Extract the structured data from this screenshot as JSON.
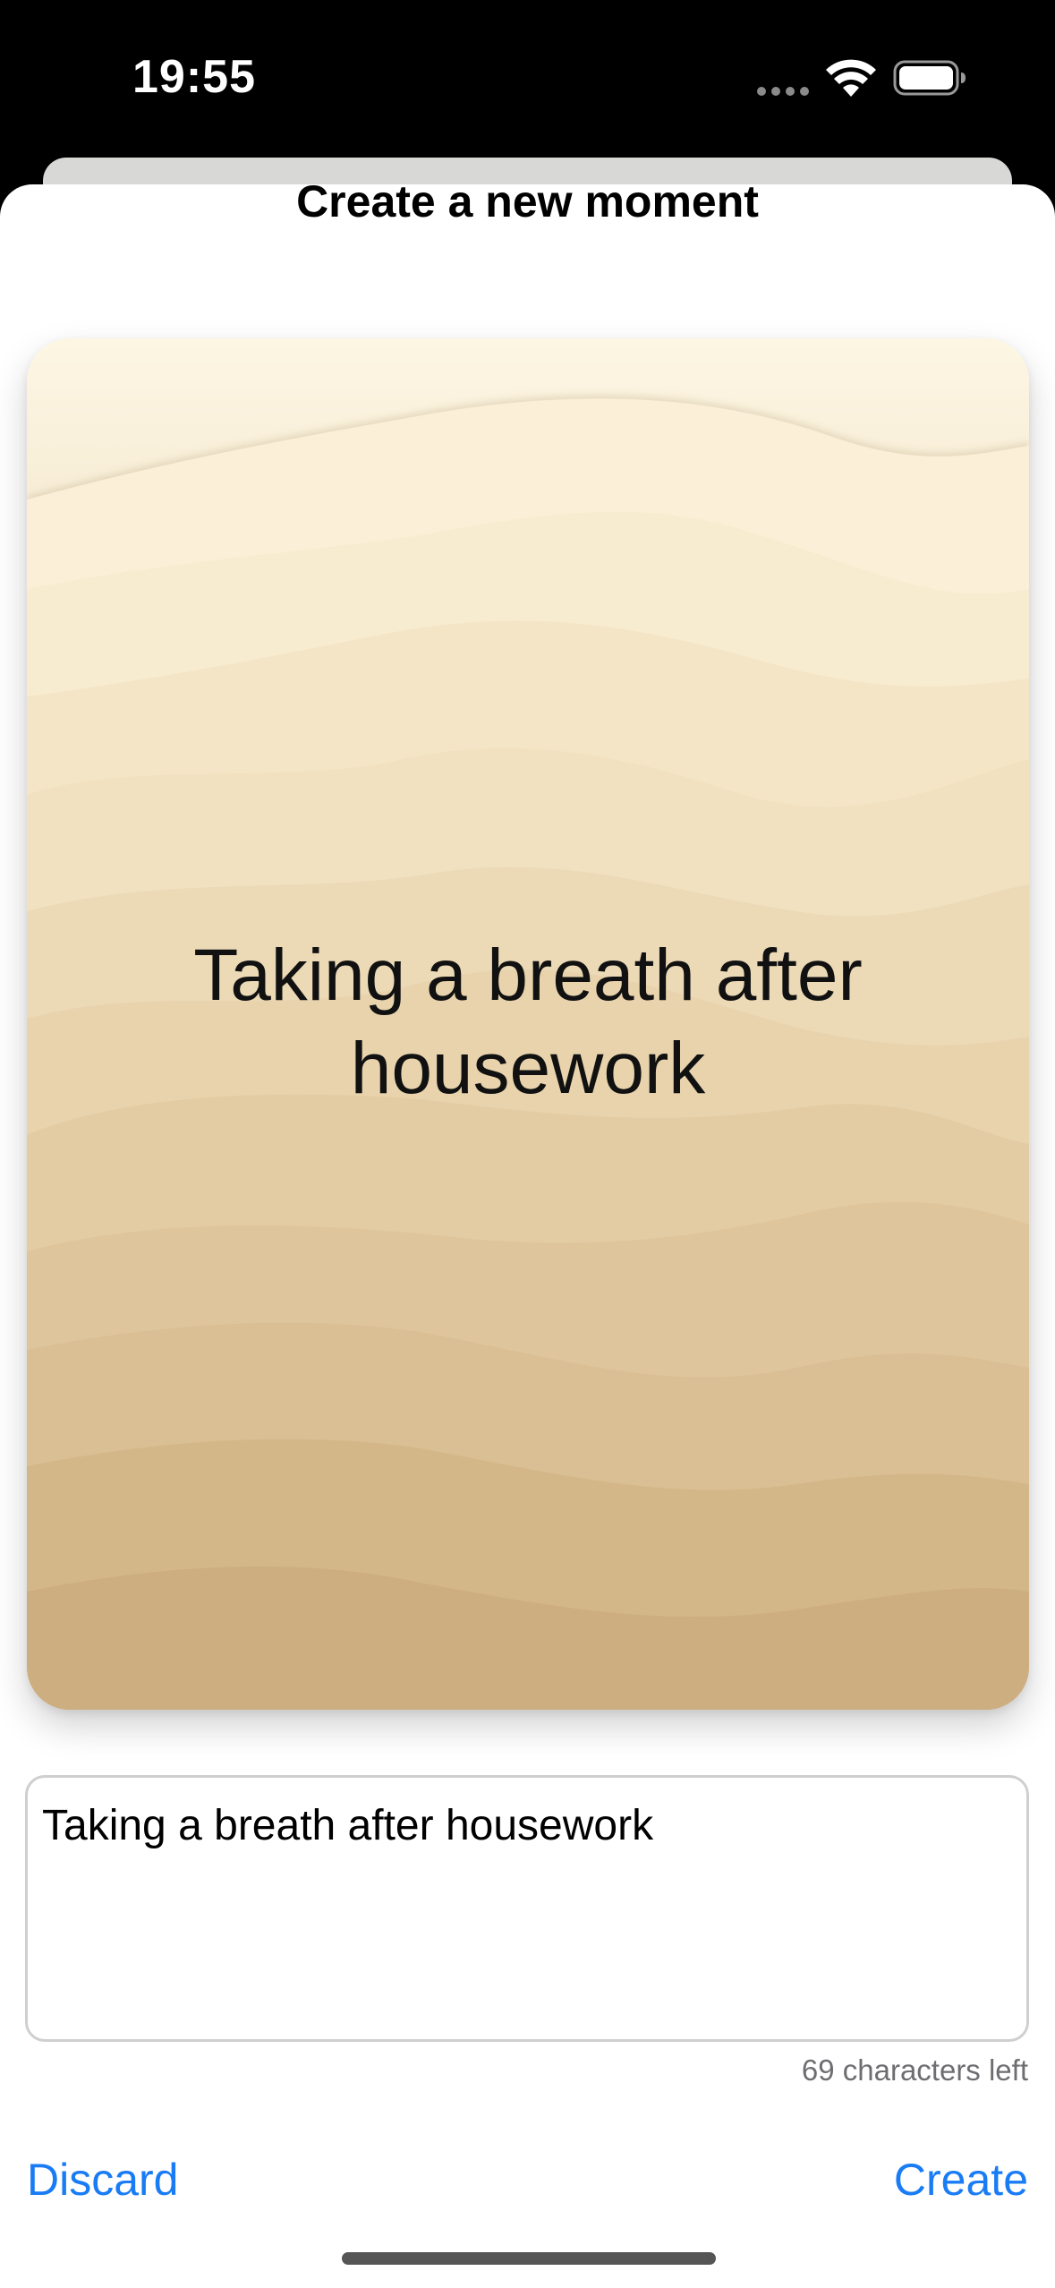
{
  "status_bar": {
    "time": "19:55",
    "icons": [
      "signal-dots-icon",
      "wifi-icon",
      "battery-icon"
    ]
  },
  "sheet": {
    "title": "Create a new moment"
  },
  "card": {
    "text": "Taking a breath after housework",
    "background_colors": [
      "#fdf6e3",
      "#f7ebd0",
      "#efdcb8",
      "#e6cfa3",
      "#d9bb8a",
      "#cdad7d"
    ]
  },
  "input": {
    "value": "Taking a breath after housework",
    "char_count": "69 characters left"
  },
  "actions": {
    "discard_label": "Discard",
    "create_label": "Create",
    "accent_color": "#1a7cf5"
  }
}
